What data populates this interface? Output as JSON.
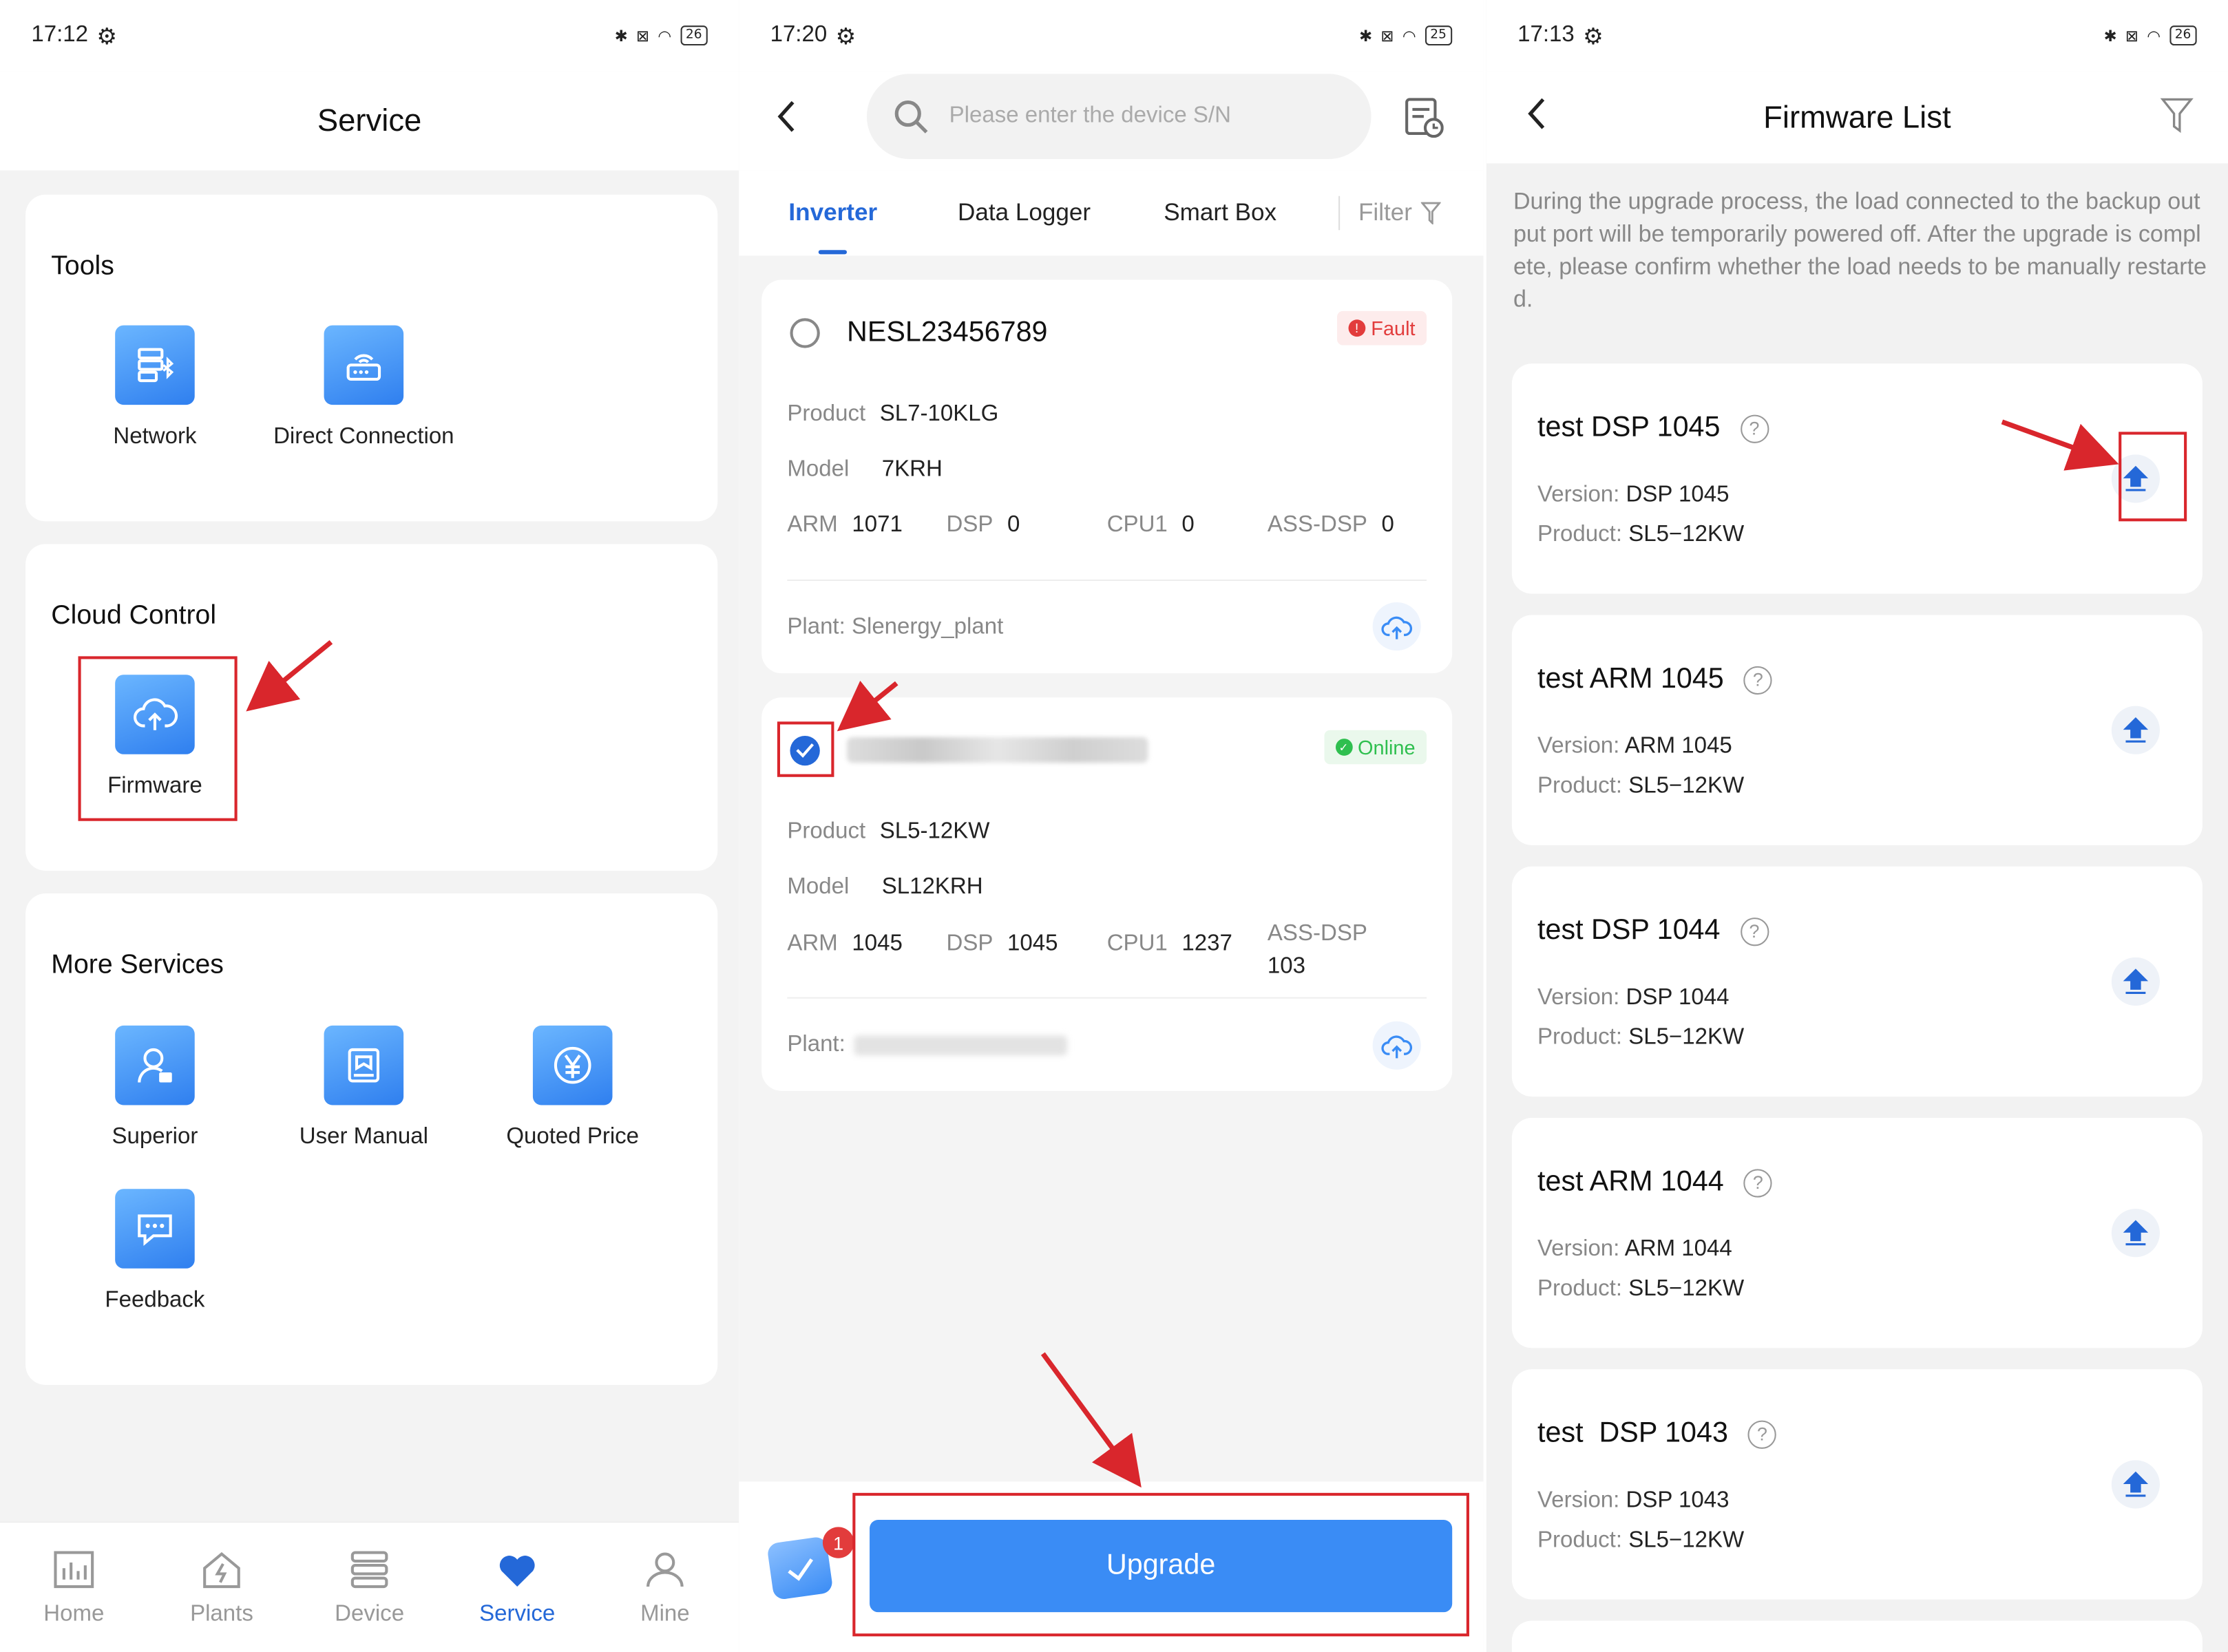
{
  "panel1": {
    "status": {
      "time": "17:12",
      "battery": "26"
    },
    "title": "Service",
    "tools": {
      "title": "Tools",
      "items": [
        {
          "label": "Network",
          "icon": "network-bluetooth-icon"
        },
        {
          "label": "Direct Connection",
          "icon": "router-icon"
        }
      ]
    },
    "cloud": {
      "title": "Cloud Control",
      "items": [
        {
          "label": "Firmware",
          "icon": "cloud-upload-icon"
        }
      ]
    },
    "more": {
      "title": "More Services",
      "items": [
        {
          "label": "Superior",
          "icon": "user-icon"
        },
        {
          "label": "User Manual",
          "icon": "book-icon"
        },
        {
          "label": "Quoted Price",
          "icon": "yen-icon"
        },
        {
          "label": "Feedback",
          "icon": "chat-icon"
        }
      ]
    },
    "nav": [
      {
        "label": "Home"
      },
      {
        "label": "Plants"
      },
      {
        "label": "Device"
      },
      {
        "label": "Service"
      },
      {
        "label": "Mine"
      }
    ]
  },
  "panel2": {
    "status": {
      "time": "17:20",
      "battery": "25"
    },
    "search": {
      "placeholder": "Please enter the device S/N"
    },
    "tabs": [
      "Inverter",
      "Data Logger",
      "Smart Box",
      "Filter"
    ],
    "devices": [
      {
        "sn": "NESL23456789",
        "status": "Fault",
        "product_label": "Product",
        "product": "SL7-10KLG",
        "model_label": "Model",
        "model": "7KRH",
        "arm_label": "ARM",
        "arm": "1071",
        "dsp_label": "DSP",
        "dsp": "0",
        "cpu1_label": "CPU1",
        "cpu1": "0",
        "assdsp_label": "ASS-DSP",
        "assdsp": "0",
        "plant": "Plant: Slenergy_plant"
      },
      {
        "sn": "",
        "status": "Online",
        "product_label": "Product",
        "product": "SL5-12KW",
        "model_label": "Model",
        "model": "SL12KRH",
        "arm_label": "ARM",
        "arm": "1045",
        "dsp_label": "DSP",
        "dsp": "1045",
        "cpu1_label": "CPU1",
        "cpu1": "1237",
        "assdsp_label": "ASS-DSP",
        "assdsp": "103",
        "plant": "Plant:"
      }
    ],
    "selected_count": "1",
    "upgrade_label": "Upgrade"
  },
  "panel3": {
    "status": {
      "time": "17:13",
      "battery": "26"
    },
    "title": "Firmware List",
    "notice": "During the upgrade process, the load connected to the backup output port will be temporarily powered off. After the upgrade is complete, please confirm whether the load needs to be manually restarted.",
    "version_label": "Version:",
    "product_label": "Product:",
    "firmwares": [
      {
        "name": "test DSP 1045",
        "version": "DSP 1045",
        "product": "SL5−12KW"
      },
      {
        "name": "test ARM 1045",
        "version": "ARM 1045",
        "product": "SL5−12KW"
      },
      {
        "name": "test DSP 1044",
        "version": "DSP 1044",
        "product": "SL5−12KW"
      },
      {
        "name": "test ARM 1044",
        "version": "ARM 1044",
        "product": "SL5−12KW"
      },
      {
        "name": "test  DSP 1043",
        "version": "DSP 1043",
        "product": "SL5−12KW"
      }
    ]
  },
  "colors": {
    "accent": "#2468d8",
    "button": "#3a8cf5",
    "annotation": "#d9262c",
    "fault": "#e23c3c",
    "online": "#2fbf4f"
  }
}
